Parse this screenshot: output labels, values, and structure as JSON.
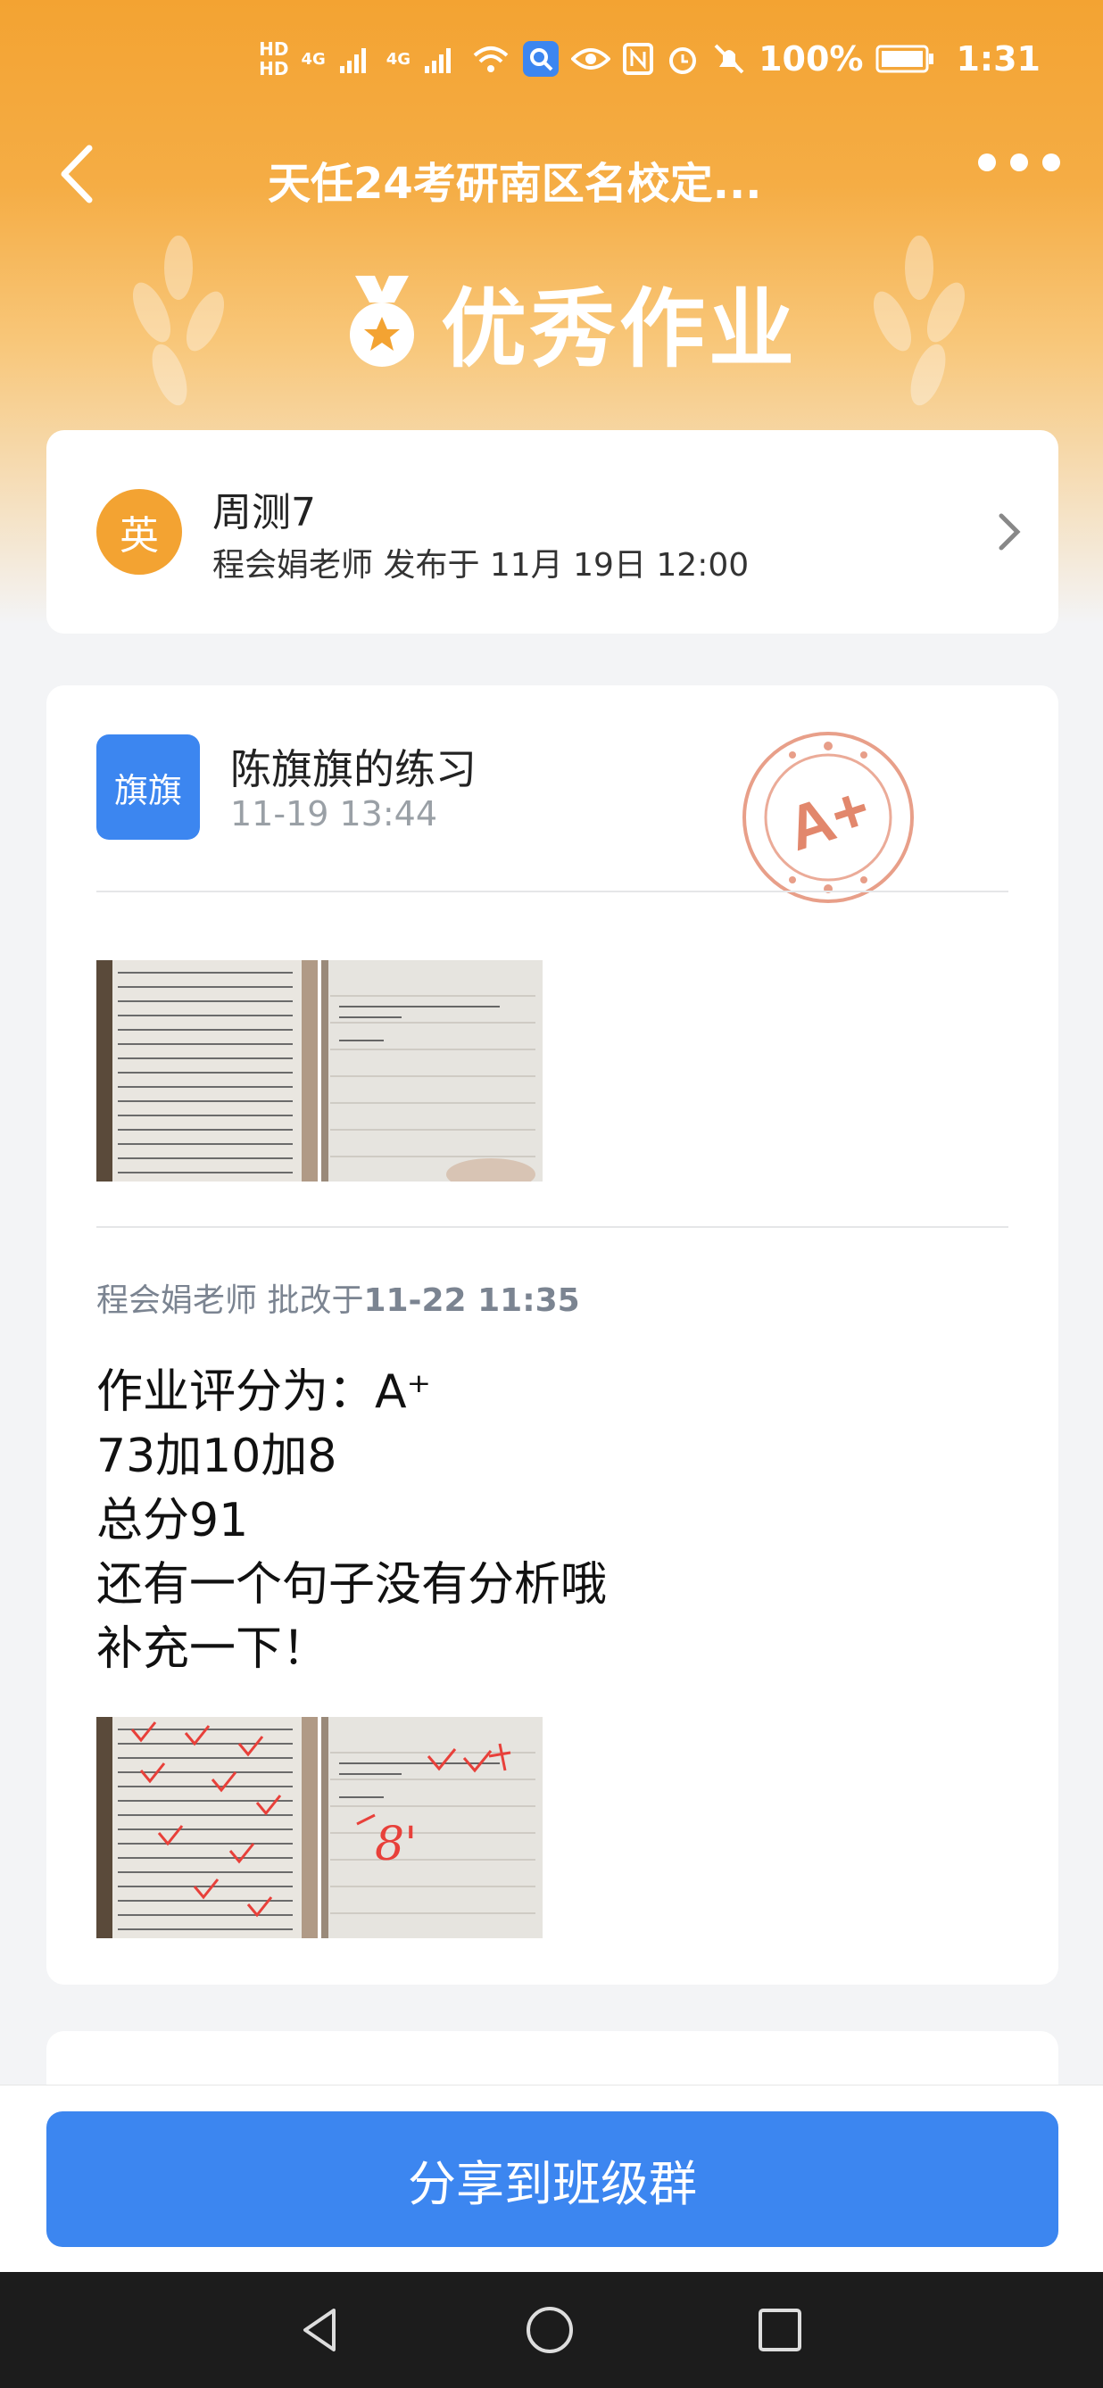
{
  "status_bar": {
    "sim1": "HD",
    "sim2": "HD",
    "net1": "4G",
    "net2": "4G",
    "battery": "100%",
    "time": "1:31"
  },
  "nav": {
    "title": "天任24考研南区名校定..."
  },
  "banner": {
    "title": "优秀作业"
  },
  "assignment": {
    "subject": "英",
    "title": "周测7",
    "publisher": "程会娟老师 发布于 11月 19日 12:00"
  },
  "submission": {
    "avatar_text": "旗旗",
    "student": "陈旗旗的练习",
    "time": "11-19 13:44",
    "grade_stamp": "A+",
    "review_prefix": "程会娟老师 批改于",
    "review_time": "11-22 11:35",
    "comment_lines": [
      "作业评分为：A⁺",
      "73加10加8",
      "总分91",
      "还有一个句子没有分析哦",
      "补充一下！"
    ],
    "marked_score": "8'"
  },
  "actions": {
    "share_label": "分享到班级群"
  },
  "colors": {
    "accent_orange": "#f3a332",
    "accent_blue": "#3c86f0",
    "stamp_red": "#e2876c"
  }
}
